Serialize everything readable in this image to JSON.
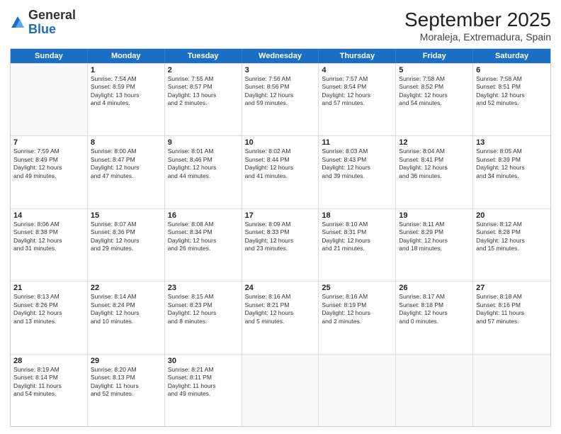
{
  "header": {
    "logo": {
      "general": "General",
      "blue": "Blue"
    },
    "title": "September 2025",
    "subtitle": "Moraleja, Extremadura, Spain"
  },
  "weekdays": [
    "Sunday",
    "Monday",
    "Tuesday",
    "Wednesday",
    "Thursday",
    "Friday",
    "Saturday"
  ],
  "weeks": [
    [
      {
        "day": null,
        "text": ""
      },
      {
        "day": "1",
        "text": "Sunrise: 7:54 AM\nSunset: 8:59 PM\nDaylight: 13 hours\nand 4 minutes."
      },
      {
        "day": "2",
        "text": "Sunrise: 7:55 AM\nSunset: 8:57 PM\nDaylight: 13 hours\nand 2 minutes."
      },
      {
        "day": "3",
        "text": "Sunrise: 7:56 AM\nSunset: 8:56 PM\nDaylight: 12 hours\nand 59 minutes."
      },
      {
        "day": "4",
        "text": "Sunrise: 7:57 AM\nSunset: 8:54 PM\nDaylight: 12 hours\nand 57 minutes."
      },
      {
        "day": "5",
        "text": "Sunrise: 7:58 AM\nSunset: 8:52 PM\nDaylight: 12 hours\nand 54 minutes."
      },
      {
        "day": "6",
        "text": "Sunrise: 7:58 AM\nSunset: 8:51 PM\nDaylight: 12 hours\nand 52 minutes."
      }
    ],
    [
      {
        "day": "7",
        "text": "Sunrise: 7:59 AM\nSunset: 8:49 PM\nDaylight: 12 hours\nand 49 minutes."
      },
      {
        "day": "8",
        "text": "Sunrise: 8:00 AM\nSunset: 8:47 PM\nDaylight: 12 hours\nand 47 minutes."
      },
      {
        "day": "9",
        "text": "Sunrise: 8:01 AM\nSunset: 8:46 PM\nDaylight: 12 hours\nand 44 minutes."
      },
      {
        "day": "10",
        "text": "Sunrise: 8:02 AM\nSunset: 8:44 PM\nDaylight: 12 hours\nand 41 minutes."
      },
      {
        "day": "11",
        "text": "Sunrise: 8:03 AM\nSunset: 8:43 PM\nDaylight: 12 hours\nand 39 minutes."
      },
      {
        "day": "12",
        "text": "Sunrise: 8:04 AM\nSunset: 8:41 PM\nDaylight: 12 hours\nand 36 minutes."
      },
      {
        "day": "13",
        "text": "Sunrise: 8:05 AM\nSunset: 8:39 PM\nDaylight: 12 hours\nand 34 minutes."
      }
    ],
    [
      {
        "day": "14",
        "text": "Sunrise: 8:06 AM\nSunset: 8:38 PM\nDaylight: 12 hours\nand 31 minutes."
      },
      {
        "day": "15",
        "text": "Sunrise: 8:07 AM\nSunset: 8:36 PM\nDaylight: 12 hours\nand 29 minutes."
      },
      {
        "day": "16",
        "text": "Sunrise: 8:08 AM\nSunset: 8:34 PM\nDaylight: 12 hours\nand 26 minutes."
      },
      {
        "day": "17",
        "text": "Sunrise: 8:09 AM\nSunset: 8:33 PM\nDaylight: 12 hours\nand 23 minutes."
      },
      {
        "day": "18",
        "text": "Sunrise: 8:10 AM\nSunset: 8:31 PM\nDaylight: 12 hours\nand 21 minutes."
      },
      {
        "day": "19",
        "text": "Sunrise: 8:11 AM\nSunset: 8:29 PM\nDaylight: 12 hours\nand 18 minutes."
      },
      {
        "day": "20",
        "text": "Sunrise: 8:12 AM\nSunset: 8:28 PM\nDaylight: 12 hours\nand 15 minutes."
      }
    ],
    [
      {
        "day": "21",
        "text": "Sunrise: 8:13 AM\nSunset: 8:26 PM\nDaylight: 12 hours\nand 13 minutes."
      },
      {
        "day": "22",
        "text": "Sunrise: 8:14 AM\nSunset: 8:24 PM\nDaylight: 12 hours\nand 10 minutes."
      },
      {
        "day": "23",
        "text": "Sunrise: 8:15 AM\nSunset: 8:23 PM\nDaylight: 12 hours\nand 8 minutes."
      },
      {
        "day": "24",
        "text": "Sunrise: 8:16 AM\nSunset: 8:21 PM\nDaylight: 12 hours\nand 5 minutes."
      },
      {
        "day": "25",
        "text": "Sunrise: 8:16 AM\nSunset: 8:19 PM\nDaylight: 12 hours\nand 2 minutes."
      },
      {
        "day": "26",
        "text": "Sunrise: 8:17 AM\nSunset: 8:18 PM\nDaylight: 12 hours\nand 0 minutes."
      },
      {
        "day": "27",
        "text": "Sunrise: 8:18 AM\nSunset: 8:16 PM\nDaylight: 11 hours\nand 57 minutes."
      }
    ],
    [
      {
        "day": "28",
        "text": "Sunrise: 8:19 AM\nSunset: 8:14 PM\nDaylight: 11 hours\nand 54 minutes."
      },
      {
        "day": "29",
        "text": "Sunrise: 8:20 AM\nSunset: 8:13 PM\nDaylight: 11 hours\nand 52 minutes."
      },
      {
        "day": "30",
        "text": "Sunrise: 8:21 AM\nSunset: 8:11 PM\nDaylight: 11 hours\nand 49 minutes."
      },
      {
        "day": null,
        "text": ""
      },
      {
        "day": null,
        "text": ""
      },
      {
        "day": null,
        "text": ""
      },
      {
        "day": null,
        "text": ""
      }
    ]
  ]
}
